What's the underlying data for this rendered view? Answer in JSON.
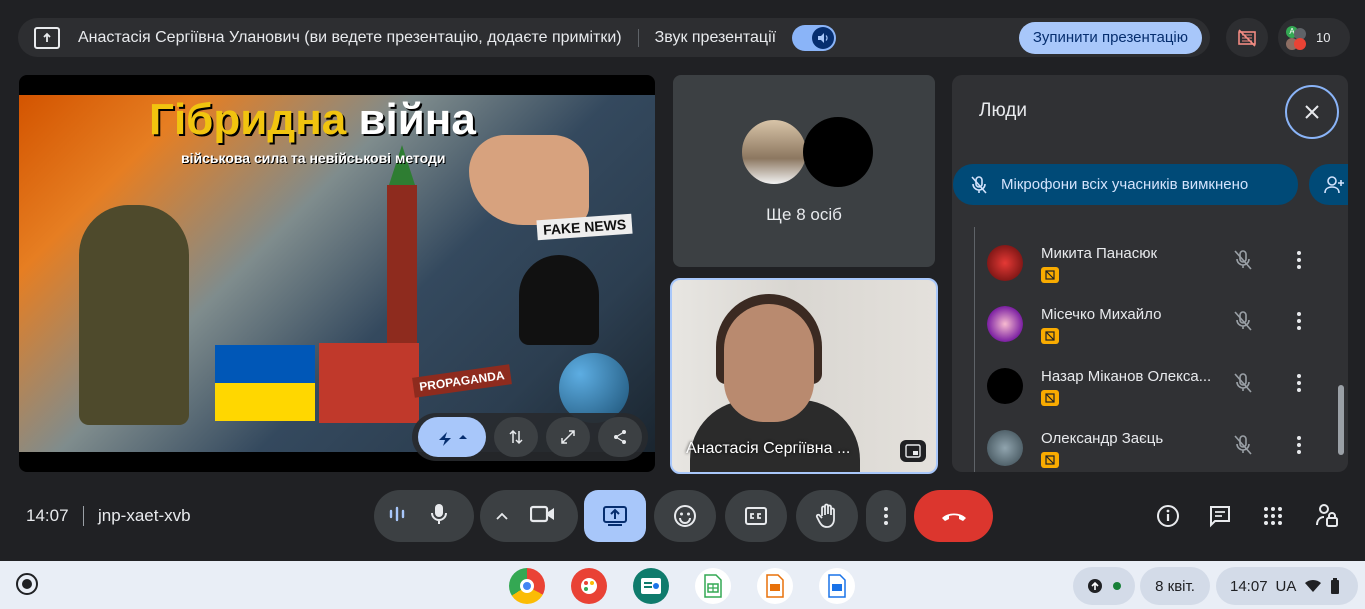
{
  "banner": {
    "presenter_text": "Анастасія Сергіївна Уланович (ви ведете презентацію, додаєте примітки)",
    "audio_label": "Звук презентації",
    "stop_label": "Зупинити презентацію"
  },
  "participants_count": "10",
  "mini_avatar_letter": "A",
  "slide": {
    "title_part1": "Гібридна",
    "title_part2": "війна",
    "subtitle": "військова сила та невійськові методи",
    "fake_news": "FAKE NEWS",
    "propaganda": "PROPAGANDA"
  },
  "others_tile": {
    "label": "Ще 8 осіб"
  },
  "self_tile": {
    "name": "Анастасія Сергіївна ..."
  },
  "people_panel": {
    "title": "Люди",
    "mute_all_label": "Мікрофони всіх учасників вимкнено",
    "participants": [
      {
        "name": "Микита Панасюк"
      },
      {
        "name": "Місечко Михайло"
      },
      {
        "name": "Назар Міканов Олекса..."
      },
      {
        "name": "Олександр Заєць"
      }
    ]
  },
  "bottom_bar": {
    "time": "14:07",
    "meeting_code": "jnp-xaet-xvb"
  },
  "shelf": {
    "date": "8 квіт.",
    "time": "14:07",
    "lang": "UA"
  },
  "colors": {
    "accent": "#a8c7fa",
    "end_call": "#dc362e",
    "panel_bg": "#303134",
    "mute_all_bg": "#004a77"
  }
}
